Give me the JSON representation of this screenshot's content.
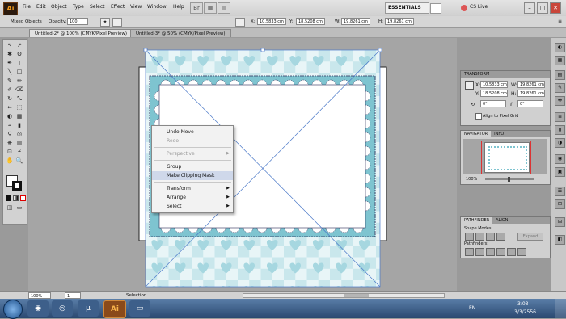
{
  "menubar": {
    "logo": "Ai",
    "items": [
      "File",
      "Edit",
      "Object",
      "Type",
      "Select",
      "Effect",
      "View",
      "Window",
      "Help"
    ],
    "workspace": "ESSENTIALS",
    "cslive": "CS Live"
  },
  "control": {
    "selection": "Mixed Objects",
    "opacity_label": "Opacity:",
    "opacity": "100",
    "x_label": "X:",
    "x": "10.5833 cm",
    "y_label": "Y:",
    "y": "18.5208 cm",
    "w_label": "W:",
    "w": "19.8261 cm",
    "h_label": "H:",
    "h": "19.8261 cm"
  },
  "tabs": [
    {
      "label": "Untitled-2* @ 100% (CMYK/Pixel Preview)"
    },
    {
      "label": "Untitled-3* @ 50% (CMYK/Pixel Preview)"
    }
  ],
  "context_menu": {
    "items": [
      {
        "label": "Undo Move",
        "enabled": true,
        "submenu": false
      },
      {
        "label": "Redo",
        "enabled": false,
        "submenu": false
      },
      {
        "label": "Perspective",
        "enabled": false,
        "submenu": true
      },
      {
        "label": "Group",
        "enabled": true,
        "submenu": false
      },
      {
        "label": "Make Clipping Mask",
        "enabled": true,
        "submenu": false,
        "highlighted": true
      },
      {
        "label": "Transform",
        "enabled": true,
        "submenu": true
      },
      {
        "label": "Arrange",
        "enabled": true,
        "submenu": true
      },
      {
        "label": "Select",
        "enabled": true,
        "submenu": true
      }
    ]
  },
  "transform_panel": {
    "title": "TRANSFORM",
    "x_label": "X:",
    "x": "10.5833 cm",
    "y_label": "Y:",
    "y": "18.5208 cm",
    "w_label": "W:",
    "w": "19.8261 cm",
    "h_label": "H:",
    "h": "19.8261 cm",
    "angle": "0°",
    "shear": "0°",
    "align_label": "Align to Pixel Grid"
  },
  "navigator_panel": {
    "tabs": [
      "NAVIGATOR",
      "INFO"
    ],
    "zoom": "100%"
  },
  "pathfinder_panel": {
    "tabs": [
      "PATHFINDER",
      "ALIGN"
    ],
    "shape_modes_label": "Shape Modes:",
    "expand_label": "Expand",
    "pathfinders_label": "Pathfinders:"
  },
  "statusbar": {
    "zoom": "100%",
    "page": "1",
    "tool": "Selection"
  },
  "taskbar": {
    "lang": "EN",
    "time": "3:03",
    "date": "3/3/2556"
  },
  "colors": {
    "pattern_light": "#c9e7ec",
    "pattern_dark": "#7ec4d0",
    "selection": "#4a78c8",
    "highlight": "#cfd8ea"
  }
}
